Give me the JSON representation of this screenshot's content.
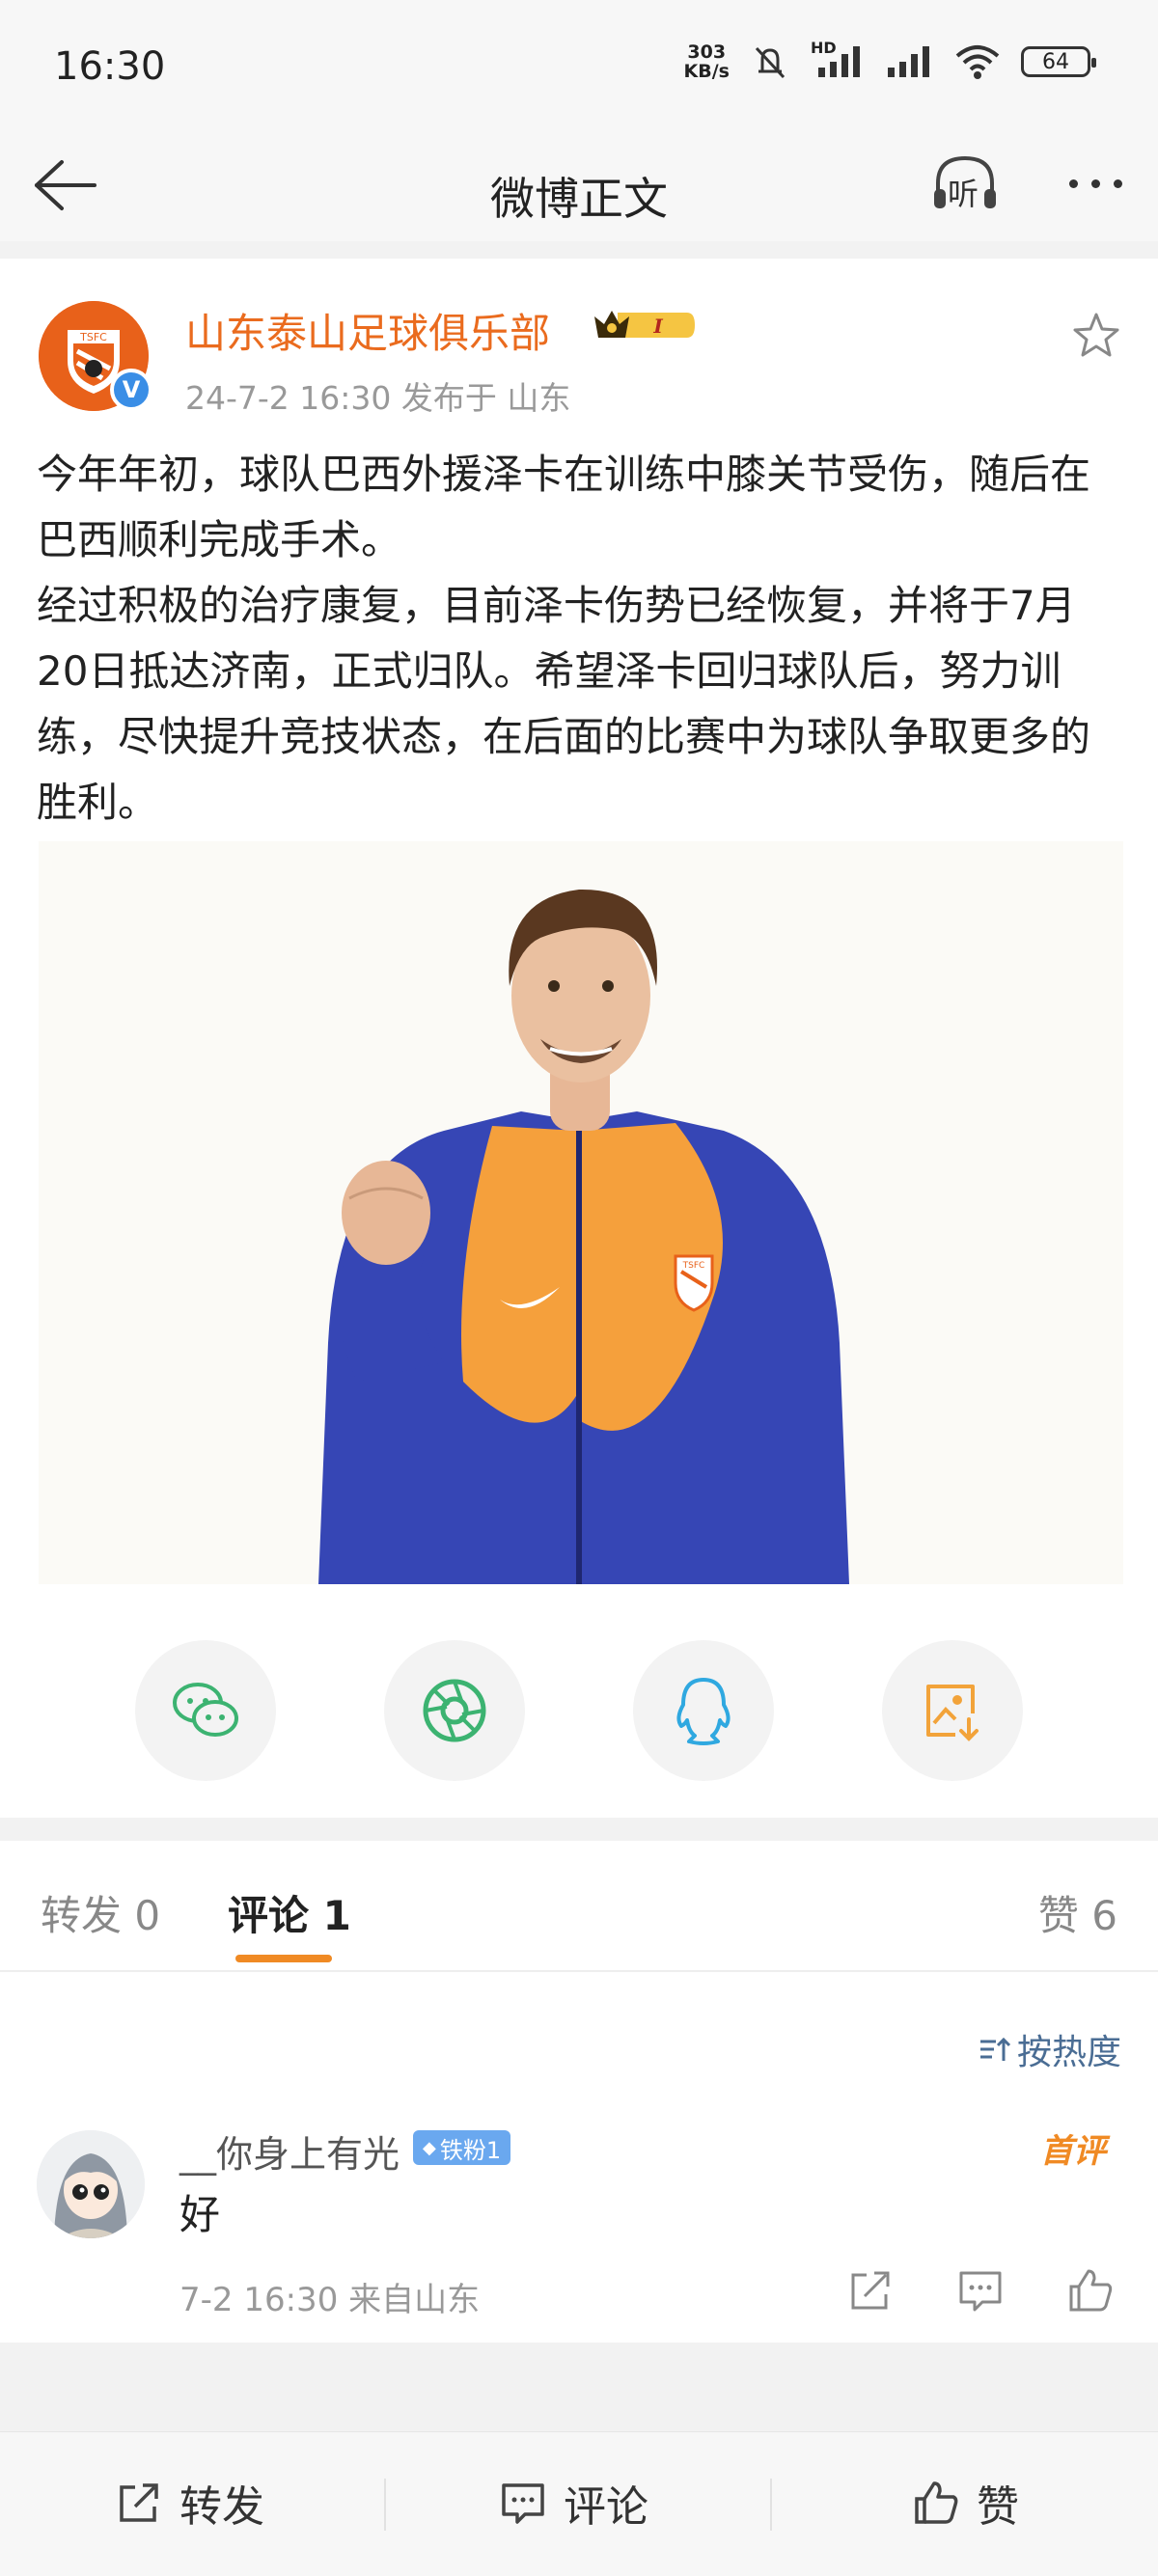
{
  "status_bar": {
    "time": "16:30",
    "net_speed_value": "303",
    "net_speed_unit": "KB/s",
    "signal_label": "HD",
    "battery": "64"
  },
  "header": {
    "title": "微博正文",
    "listen_label": "听"
  },
  "post": {
    "author": "山东泰山足球俱乐部",
    "vip_level": "I",
    "avatar_text": "TSFC",
    "verified_mark": "V",
    "meta": "24-7-2 16:30  发布于 山东",
    "text": "今年年初，球队巴西外援泽卡在训练中膝关节受伤，随后在巴西顺利完成手术。\n经过积极的治疗康复，目前泽卡伤势已经恢复，并将于7月20日抵达济南，正式归队。希望泽卡回归球队后，努力训练，尽快提升竞技状态，在后面的比赛中为球队争取更多的胜利。",
    "image_badge_text": "TSFC"
  },
  "share_icons": [
    "wechat-icon",
    "moments-icon",
    "qq-icon",
    "save-image-icon"
  ],
  "colors": {
    "accent_orange": "#ea6b1e",
    "tab_underline": "#f08a24",
    "verified_blue": "#3a8ee6",
    "wechat_green": "#3cb371",
    "qq_blue": "#2fa8e0",
    "save_orange": "#f2a33a"
  },
  "tabs": {
    "repost": "转发 0",
    "comment": "评论 1",
    "like": "赞 6"
  },
  "sort": {
    "label": "按热度"
  },
  "comment": {
    "username": "__你身上有光",
    "badge": "铁粉1",
    "first_label": "首评",
    "text": "好",
    "meta": "7-2 16:30  来自山东"
  },
  "bottom_bar": {
    "repost": "转发",
    "comment": "评论",
    "like": "赞"
  }
}
